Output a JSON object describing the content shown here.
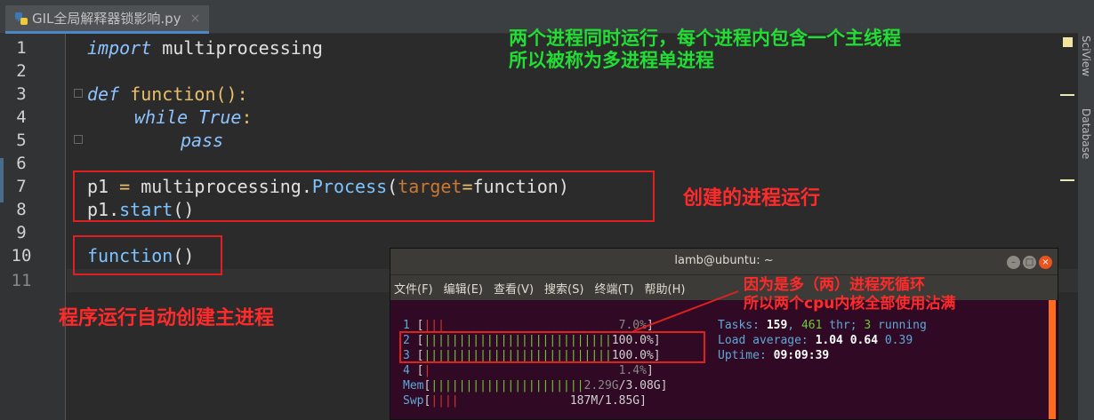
{
  "tab": {
    "label": "GIL全局解释器锁影响.py",
    "close": "×"
  },
  "gutter": {
    "lines": [
      "1",
      "2",
      "3",
      "4",
      "5",
      "6",
      "7",
      "8",
      "9",
      "10",
      "11"
    ]
  },
  "code": {
    "l1_kw": "import",
    "l1_rest": " multiprocessing",
    "l3_kw": "def",
    "l3_fn": " function",
    "l3_rest": "():",
    "l4_kw": "while",
    "l4_true": " True",
    "l4_colon": ":",
    "l5_kw": "pass",
    "l7_a": "p1 ",
    "l7_eq": "=",
    "l7_b": " multiprocessing.",
    "l7_cls": "Process",
    "l7_c": "(",
    "l7_param": "target",
    "l7_eq2": "=",
    "l7_d": "function)",
    "l8_a": "p1.",
    "l8_fn": "start",
    "l8_b": "()",
    "l10_fn": "function",
    "l10_b": "()"
  },
  "annotations": {
    "green_1": "两个进程同时运行，每个进程内包含一个主线程",
    "green_2": "所以被称为多进程单进程",
    "create": "创建的进程运行",
    "main": "程序运行自动创建主进程",
    "dead_1": "因为是多（两）进程死循环",
    "dead_2": "所以两个cpu内核全部使用沾满"
  },
  "right_tabs": {
    "sciview": "SciView",
    "database": "Database"
  },
  "terminal": {
    "title": "lamb@ubuntu: ~",
    "menu": [
      "文件(F)",
      "编辑(E)",
      "查看(V)",
      "搜索(S)",
      "终端(T)",
      "帮助(H)"
    ],
    "cpu": [
      {
        "num": "1",
        "bar": "|||",
        "pct": "7.0%"
      },
      {
        "num": "2",
        "bar": "|||||||||||||||||||||||||||",
        "pct": "100.0%"
      },
      {
        "num": "3",
        "bar": "|||||||||||||||||||||||||||",
        "pct": "100.0%"
      },
      {
        "num": "4",
        "bar": "|",
        "pct": "1.4%"
      }
    ],
    "mem": {
      "label": "Mem",
      "bar": "||||||||||||||||||||||",
      "used": "2.29G",
      "total": "3.08G"
    },
    "swp": {
      "label": "Swp",
      "bar": "||||",
      "value": "187M/1.85G"
    },
    "tasks_label": "Tasks: ",
    "tasks": "159",
    "thr": "461",
    "thr_label": " thr; ",
    "running": "3",
    "running_label": " running",
    "load_label": "Load average: ",
    "load1": "1.04",
    "load5": "0.64",
    "load15": "0.39",
    "uptime_label": "Uptime: ",
    "uptime": "09:09:39"
  },
  "colors": {
    "accent": "#4a88c7",
    "annotation_red": "#ff2a2a",
    "annotation_green": "#22dd33",
    "terminal_bg": "#300a24"
  }
}
